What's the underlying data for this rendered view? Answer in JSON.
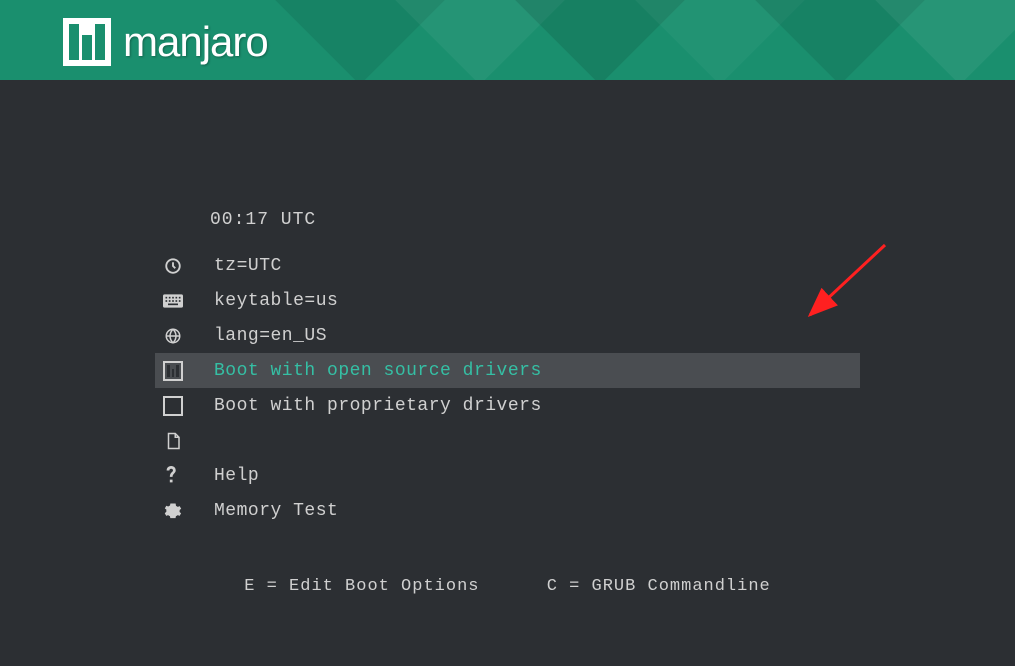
{
  "brand": "manjaro",
  "clock": "00:17 UTC",
  "menu": [
    {
      "icon": "clock-icon",
      "label": "tz=UTC",
      "selected": false
    },
    {
      "icon": "keyboard-icon",
      "label": "keytable=us",
      "selected": false
    },
    {
      "icon": "globe-icon",
      "label": "lang=en_US",
      "selected": false
    },
    {
      "icon": "manjaro-mini-icon",
      "label": "Boot with open source drivers",
      "selected": true
    },
    {
      "icon": "manjaro-mini-icon",
      "label": "Boot with proprietary drivers",
      "selected": false
    },
    {
      "icon": "document-icon",
      "label": "",
      "selected": false
    },
    {
      "icon": "question-icon",
      "label": "Help",
      "selected": false
    },
    {
      "icon": "gear-icon",
      "label": "Memory Test",
      "selected": false
    }
  ],
  "footer": {
    "edit": "E = Edit Boot Options",
    "grub": "C = GRUB Commandline"
  }
}
